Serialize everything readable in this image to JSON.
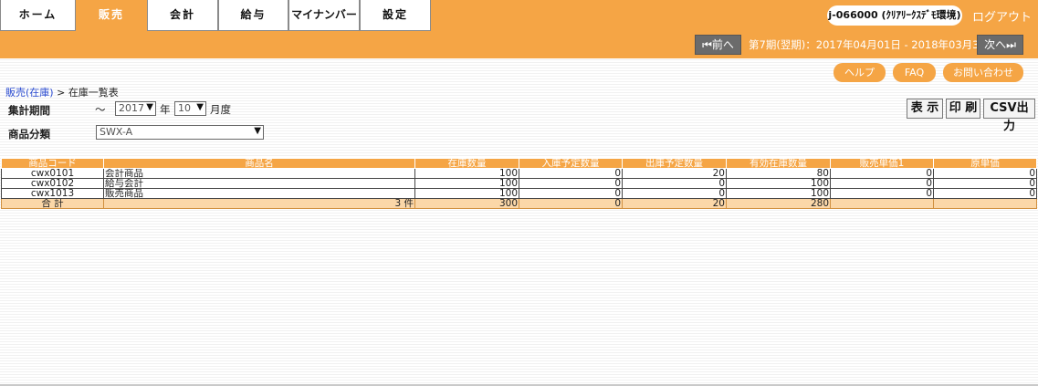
{
  "tabs": [
    {
      "label": "ホーム"
    },
    {
      "label": "販売"
    },
    {
      "label": "会計"
    },
    {
      "label": "給与"
    },
    {
      "label": "マイナンバー"
    },
    {
      "label": "設定"
    }
  ],
  "header": {
    "user_id": "j-066000 (ｸﾘｱﾘｰｸｽﾃﾞﾓ環境)",
    "logout_label": "ログアウト",
    "prev_label": "⏮前へ",
    "next_label": "次へ⏭",
    "period_text": "第7期(翌期)：2017年04月01日 - 2018年03月31日"
  },
  "help_buttons": {
    "help": "ヘルプ",
    "faq": "FAQ",
    "contact": "お問い合わせ"
  },
  "breadcrumb": {
    "link": "販売(在庫)",
    "separator": " > ",
    "current": "在庫一覧表"
  },
  "filters": {
    "period_label": "集計期間",
    "tilde": "～",
    "year_value": "2017",
    "year_unit": "年",
    "month_value": "10",
    "month_unit": "月度",
    "category_label": "商品分類",
    "category_value": "SWX-A"
  },
  "actions": {
    "show": "表 示",
    "print": "印 刷",
    "csv": "CSV出力"
  },
  "table": {
    "headers": [
      "商品コード",
      "商品名",
      "在庫数量",
      "入庫予定数量",
      "出庫予定数量",
      "有効在庫数量",
      "販売単価1",
      "原単価"
    ],
    "rows": [
      {
        "code": "cwx0101",
        "name": "会計商品",
        "stock": "100",
        "incoming": "0",
        "outgoing": "20",
        "available": "80",
        "price": "0",
        "cost": "0"
      },
      {
        "code": "cwx0102",
        "name": "給与会計",
        "stock": "100",
        "incoming": "0",
        "outgoing": "0",
        "available": "100",
        "price": "0",
        "cost": "0"
      },
      {
        "code": "cwx1013",
        "name": "販売商品",
        "stock": "100",
        "incoming": "0",
        "outgoing": "0",
        "available": "100",
        "price": "0",
        "cost": "0"
      }
    ],
    "total": {
      "label": "合 計",
      "count": "3 件",
      "stock": "300",
      "incoming": "0",
      "outgoing": "20",
      "available": "280",
      "price": "",
      "cost": ""
    }
  },
  "colors": {
    "accent": "#f5a545",
    "total_row": "#fbd7a8",
    "link": "#2a4bd1"
  }
}
